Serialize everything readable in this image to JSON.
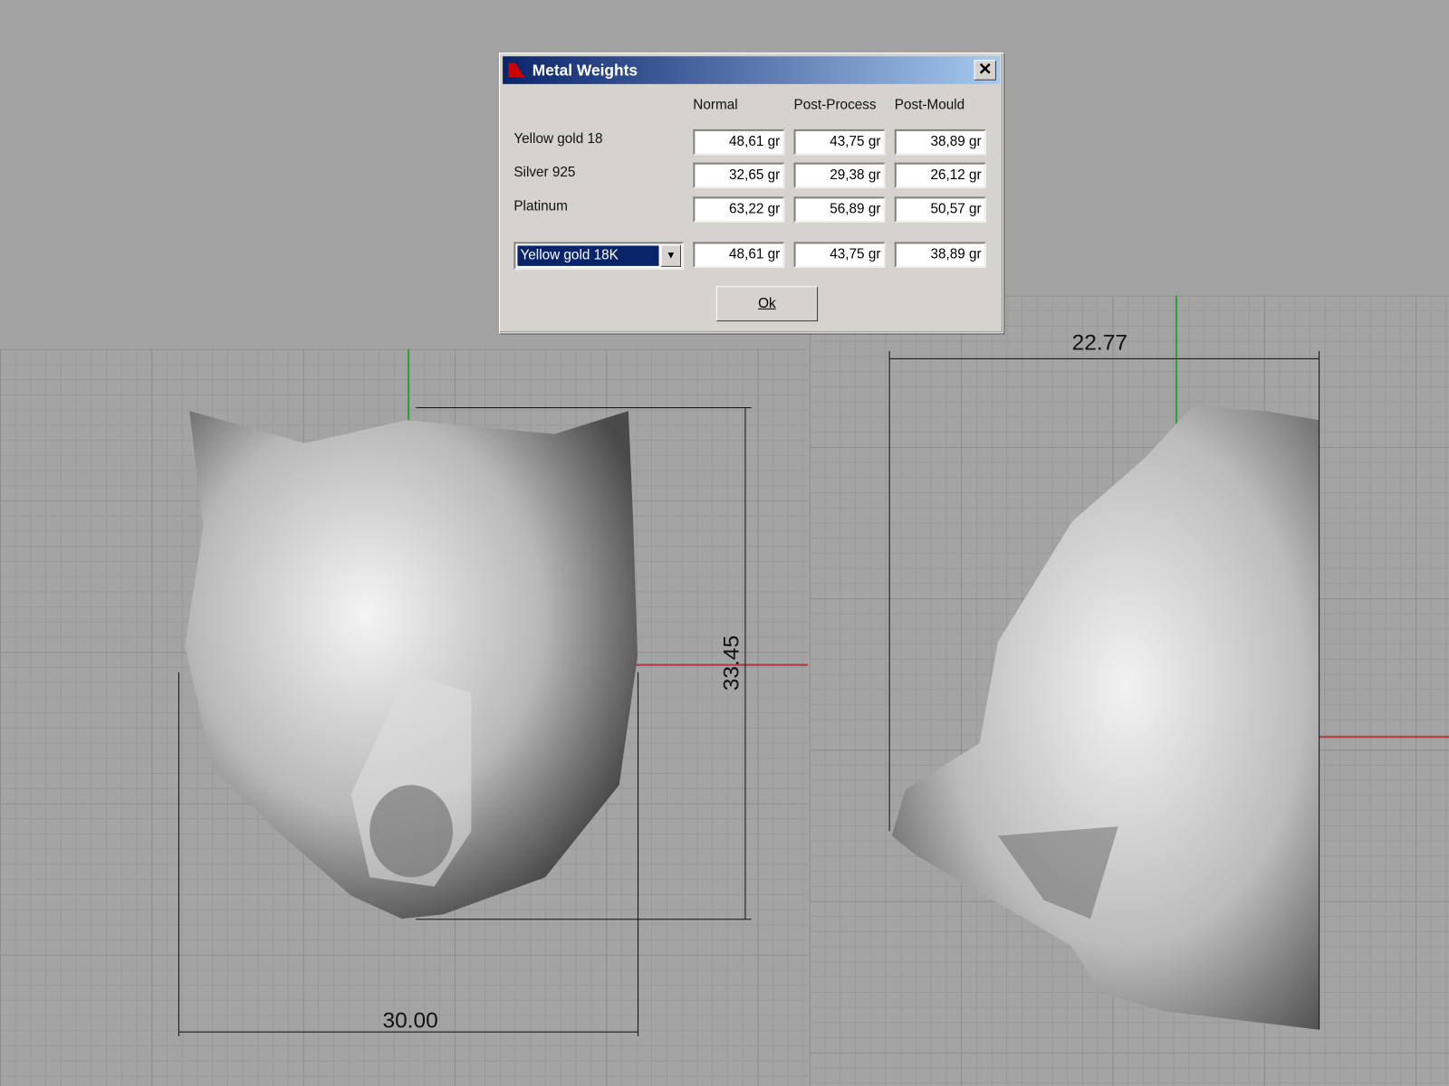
{
  "dialog": {
    "title": "Metal Weights",
    "columns": [
      "Normal",
      "Post-Process",
      "Post-Mould"
    ],
    "rows": [
      {
        "label": "Yellow gold 18",
        "values": [
          "48,61 gr",
          "43,75 gr",
          "38,89 gr"
        ]
      },
      {
        "label": "Silver 925",
        "values": [
          "32,65 gr",
          "29,38 gr",
          "26,12 gr"
        ]
      },
      {
        "label": "Platinum",
        "values": [
          "63,22 gr",
          "56,89 gr",
          "50,57 gr"
        ]
      }
    ],
    "selected_metal": "Yellow gold 18K",
    "selected_values": [
      "48,61 gr",
      "43,75 gr",
      "38,89 gr"
    ],
    "ok_label": "Ok",
    "close_label": "✕"
  },
  "dimensions": {
    "front_width": "30.00",
    "front_height": "33.45",
    "side_width": "22.77"
  },
  "colors": {
    "axis_x": "#c0392b",
    "axis_y": "#2e9e3e",
    "titlebar": "#0a246a"
  }
}
